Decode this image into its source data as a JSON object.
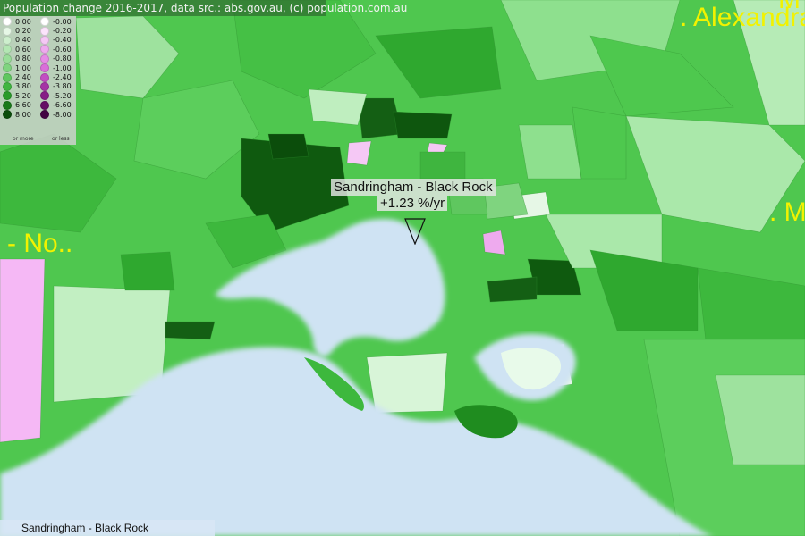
{
  "header": {
    "attribution": "Population change 2016-2017, data src.: abs.gov.au, (c) population.com.au"
  },
  "legend": {
    "positive": [
      {
        "label": "0.00",
        "color": "#ffffff"
      },
      {
        "label": "0.20",
        "color": "#e6f7e6"
      },
      {
        "label": "0.40",
        "color": "#cdeecd"
      },
      {
        "label": "0.60",
        "color": "#b3e6b3"
      },
      {
        "label": "0.80",
        "color": "#99dd99"
      },
      {
        "label": "1.00",
        "color": "#7fd47f"
      },
      {
        "label": "2.40",
        "color": "#5fc75f"
      },
      {
        "label": "3.80",
        "color": "#3fb53f"
      },
      {
        "label": "5.20",
        "color": "#2a9a2a"
      },
      {
        "label": "6.60",
        "color": "#1a7a1a"
      },
      {
        "label": "8.00",
        "color": "#0b4d0b"
      }
    ],
    "negative": [
      {
        "label": "-0.00",
        "color": "#ffffff"
      },
      {
        "label": "-0.20",
        "color": "#fbe4fb"
      },
      {
        "label": "-0.40",
        "color": "#f5c8f5"
      },
      {
        "label": "-0.60",
        "color": "#eeaaee"
      },
      {
        "label": "-0.80",
        "color": "#e58ce5"
      },
      {
        "label": "-1.00",
        "color": "#d96ed9"
      },
      {
        "label": "-2.40",
        "color": "#c24ec2"
      },
      {
        "label": "-3.80",
        "color": "#a534a5"
      },
      {
        "label": "-5.20",
        "color": "#861e86"
      },
      {
        "label": "-6.60",
        "color": "#650e65"
      },
      {
        "label": "-8.00",
        "color": "#420442"
      }
    ],
    "pos_note": "or more",
    "neg_note": "or less"
  },
  "places": {
    "alexandra": ". Alexandra",
    "m_top": "M",
    "m_right": ". Me",
    "no_left": "- No.."
  },
  "popup": {
    "name": "Sandringham - Black Rock",
    "value": "+1.23 %/yr"
  },
  "status": {
    "selected": "Sandringham - Black Rock"
  }
}
